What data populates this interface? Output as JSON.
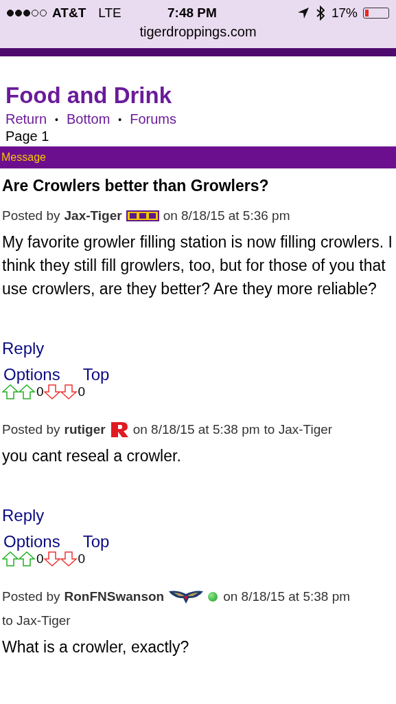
{
  "status_bar": {
    "carrier": "AT&T",
    "network": "LTE",
    "time": "7:48 PM",
    "battery": "17%"
  },
  "address_bar": {
    "url": "tigerdroppings.com"
  },
  "board": {
    "title": "Food and Drink",
    "links": [
      "Return",
      "Bottom",
      "Forums"
    ],
    "separator": "•",
    "page": "Page 1"
  },
  "section_bar": {
    "label": "Message"
  },
  "thread": {
    "title": "Are Crowlers better than Growlers?"
  },
  "posts": [
    {
      "prefix": "Posted by",
      "author": "Jax-Tiger",
      "kind": "lsu",
      "online": false,
      "date": "on 8/18/15 at 5:36 pm",
      "body": "My favorite growler filling station is now filling crowlers. I think they still fill growlers, too, but for those of you that use crowlers, are they better? Are they more reliable?",
      "actions": [
        "Reply",
        "Options",
        "Top"
      ],
      "up": "0",
      "down": "0"
    },
    {
      "prefix": "Posted by",
      "author": "rutiger",
      "kind": "rutgers",
      "online": false,
      "date": "on 8/18/15 at 5:38 pm",
      "reply_to": "to Jax-Tiger",
      "body": "you cant reseal a crowler.",
      "actions": [
        "Reply",
        "Options",
        "Top"
      ],
      "up": "0",
      "down": "0"
    },
    {
      "prefix": "Posted by",
      "author": "RonFNSwanson",
      "kind": "pelicans",
      "online": true,
      "date": "on 8/18/15 at 5:38 pm",
      "reply_to": "to Jax-Tiger",
      "body": "What is a crowler, exactly?"
    }
  ]
}
